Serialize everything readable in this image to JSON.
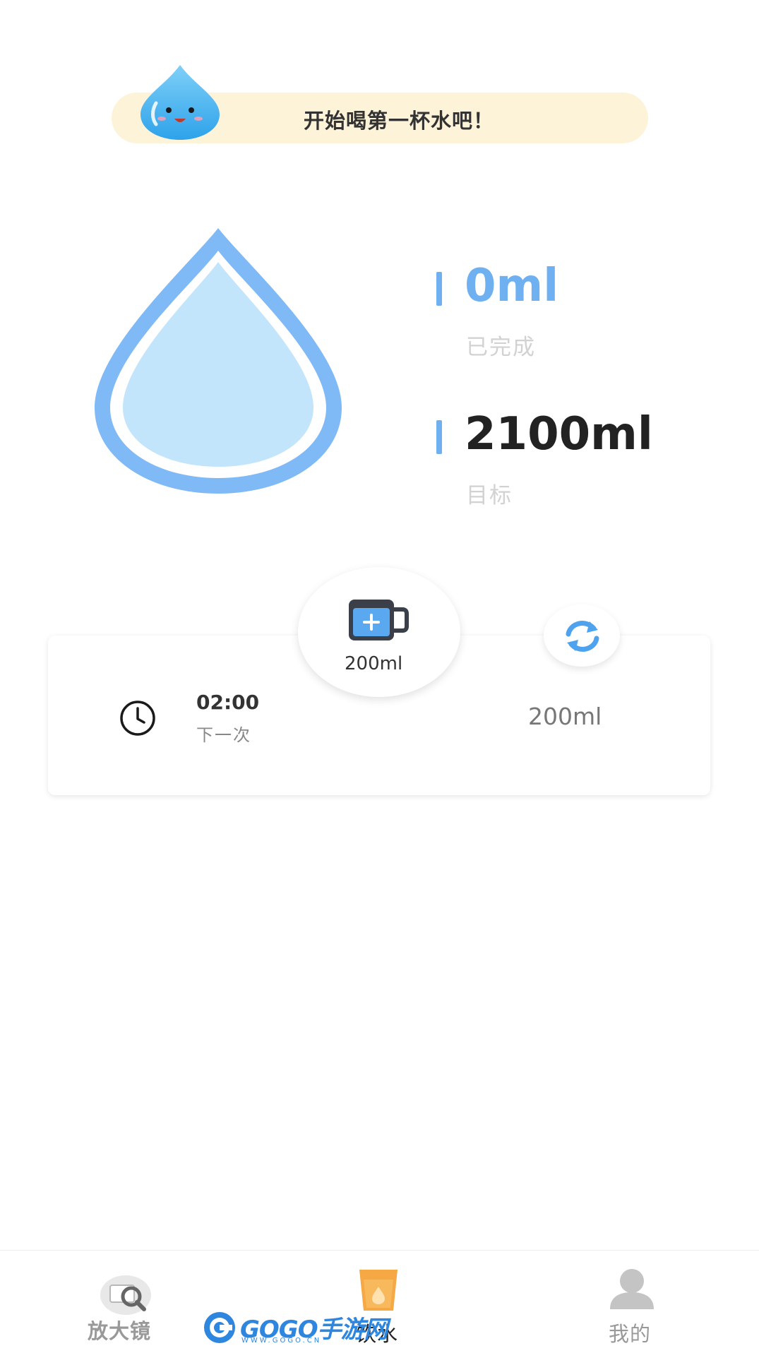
{
  "banner": {
    "message": "开始喝第一杯水吧！",
    "mascot_icon": "water-drop-mascot-icon"
  },
  "progress": {
    "completed_value": "0ml",
    "completed_label": "已完成",
    "target_value": "2100ml",
    "target_label": "目标",
    "fill_fraction": 0,
    "accent_color": "#6fb0f0"
  },
  "card": {
    "next_time": "02:00",
    "next_label": "下一次",
    "amount": "200ml",
    "add_cup_amount": "200ml",
    "clock_icon": "clock-icon",
    "cup_icon": "add-cup-icon",
    "refresh_icon": "refresh-icon"
  },
  "bottom_nav": {
    "items": [
      {
        "label": "放大镜",
        "icon": "magnifier-icon",
        "active": false
      },
      {
        "label": "饮水",
        "icon": "water-cup-icon",
        "active": true
      },
      {
        "label": "我的",
        "icon": "user-icon",
        "active": false
      }
    ]
  },
  "watermark": {
    "text": "GOGO手游网",
    "sub": "WWW.GOGO.CN"
  }
}
